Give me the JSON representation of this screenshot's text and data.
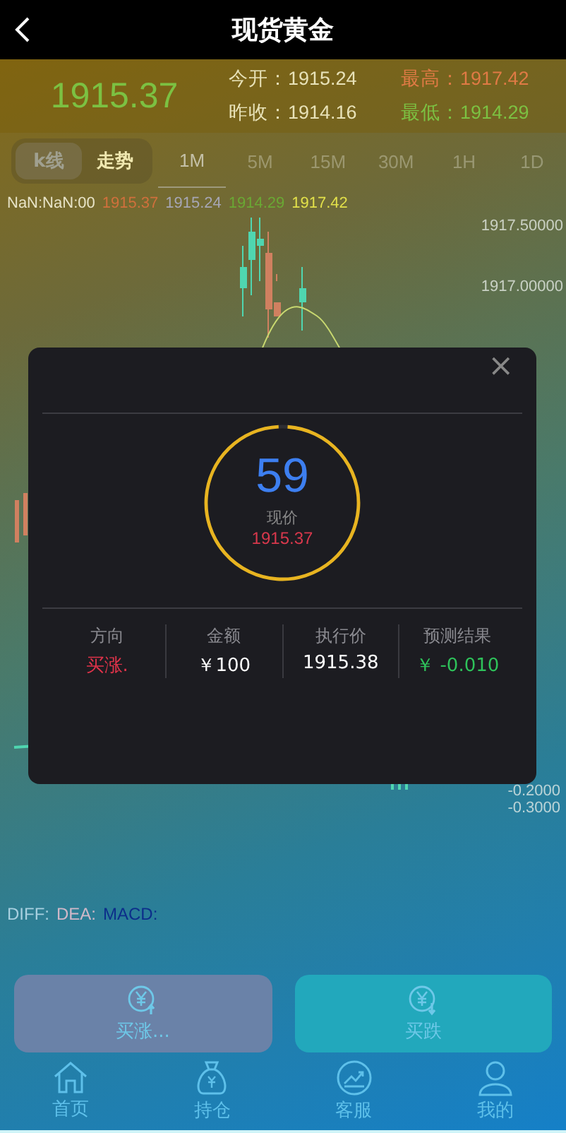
{
  "header": {
    "title": "现货黄金"
  },
  "quote": {
    "price": "1915.37",
    "stats": [
      {
        "label": "今开：",
        "value": "1915.24",
        "kind": "neutral"
      },
      {
        "label": "最高：",
        "value": "1917.42",
        "kind": "high"
      },
      {
        "label": "昨收：",
        "value": "1914.16",
        "kind": "neutral"
      },
      {
        "label": "最低：",
        "value": "1914.29",
        "kind": "low"
      }
    ]
  },
  "mode_tabs": [
    {
      "label": "k线",
      "selected": true
    },
    {
      "label": "走势",
      "selected": false
    }
  ],
  "period_tabs": [
    {
      "label": "1M",
      "selected": true
    },
    {
      "label": "5M",
      "selected": false
    },
    {
      "label": "15M",
      "selected": false
    },
    {
      "label": "30M",
      "selected": false
    },
    {
      "label": "1H",
      "selected": false
    },
    {
      "label": "1D",
      "selected": false
    }
  ],
  "legend": [
    {
      "text": "NaN:NaN:00",
      "color": "#e8e4c8"
    },
    {
      "text": "1915.37",
      "color": "#d0703c"
    },
    {
      "text": "1915.24",
      "color": "#a6a6b4"
    },
    {
      "text": "1914.29",
      "color": "#6aa834"
    },
    {
      "text": "1917.42",
      "color": "#e2e04a"
    }
  ],
  "price_axis": [
    "1917.50000",
    "1917.00000"
  ],
  "macd_axis": [
    "-0.2000",
    "-0.3000"
  ],
  "macd_legend": [
    {
      "text": "DIFF:",
      "color": "#a8d0e0"
    },
    {
      "text": "DEA:",
      "color": "#d0b8c8"
    },
    {
      "text": "MACD:",
      "color": "#0c2e8a"
    }
  ],
  "order_dialog": {
    "close": "×",
    "countdown": {
      "seconds": "59",
      "level": 0.98
    },
    "price_label": "现价",
    "price": "1915.37",
    "details": [
      {
        "label": "方向",
        "value": "买涨.",
        "kind": "up"
      },
      {
        "label": "金额",
        "value": "￥100",
        "kind": "plain"
      },
      {
        "label": "执行价",
        "value": "1915.38",
        "kind": "plain"
      },
      {
        "label": "预测结果",
        "value": "￥ -0.010",
        "kind": "profit"
      }
    ]
  },
  "trade_buttons": [
    {
      "label": "买涨...",
      "kind": "up"
    },
    {
      "label": "买跌",
      "kind": "down"
    }
  ],
  "nav": [
    {
      "label": "首页",
      "kind": "home"
    },
    {
      "label": "持仓",
      "kind": "bag"
    },
    {
      "label": "客服",
      "kind": "chart"
    },
    {
      "label": "我的",
      "kind": "user"
    }
  ]
}
